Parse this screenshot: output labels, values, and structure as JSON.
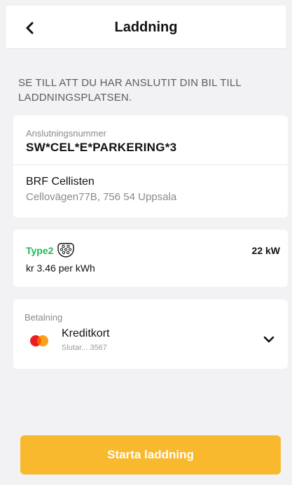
{
  "header": {
    "title": "Laddning",
    "back_icon": "chevron-left-icon"
  },
  "instruction": "SE TILL ATT DU HAR ANSLUTIT DIN BIL TILL LADDNINGSPLATSEN.",
  "connection": {
    "label": "Anslutningsnummer",
    "number": "SW*CEL*E*PARKERING*3",
    "site_name": "BRF Cellisten",
    "site_address": "Cellovägen77B, 756 54 Uppsala"
  },
  "connector": {
    "type": "Type2",
    "type_color": "#22b85c",
    "icon": "type2-connector-icon",
    "power": "22 kW",
    "price": "kr 3.46 per kWh"
  },
  "payment": {
    "label": "Betalning",
    "method": "Kreditkort",
    "card_sub": "Slutar... 3567",
    "card_icon": "mastercard-icon",
    "chevron_icon": "chevron-down-icon"
  },
  "start_button": {
    "label": "Starta laddning",
    "color": "#f9b92f"
  }
}
